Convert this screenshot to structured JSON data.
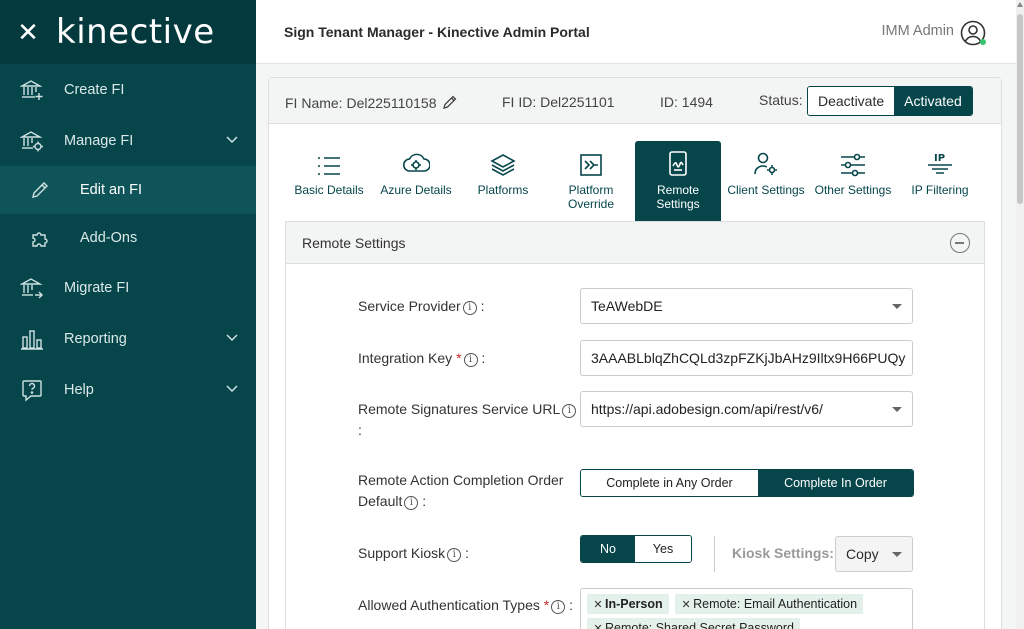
{
  "app": {
    "brand": "kinective",
    "title": "Sign Tenant Manager - Kinective Admin Portal",
    "user": "IMM Admin"
  },
  "sidebar": {
    "items": [
      {
        "label": "Create FI"
      },
      {
        "label": "Manage FI"
      },
      {
        "label": "Edit an FI"
      },
      {
        "label": "Add-Ons"
      },
      {
        "label": "Migrate FI"
      },
      {
        "label": "Reporting"
      },
      {
        "label": "Help"
      }
    ]
  },
  "info": {
    "fi_name": "FI Name: Del225110158",
    "fi_id": "FI ID: Del2251101",
    "id": "ID: 1494",
    "status_label": "Status:",
    "deactivate": "Deactivate",
    "activated": "Activated"
  },
  "tabs": [
    {
      "label": "Basic Details"
    },
    {
      "label": "Azure Details"
    },
    {
      "label": "Platforms"
    },
    {
      "label": "Platform Override"
    },
    {
      "label": "Remote Settings"
    },
    {
      "label": "Client Settings"
    },
    {
      "label": "Other Settings"
    },
    {
      "label": "IP Filtering"
    }
  ],
  "section": {
    "title": "Remote Settings",
    "service_provider": {
      "label": "Service Provider",
      "value": "TeAWebDE"
    },
    "integration_key": {
      "label": "Integration Key",
      "value": "3AAABLblqZhCQLd3zpFZKjJbAHz9Iltx9H66PUQy"
    },
    "remote_url": {
      "label": "Remote Signatures Service URL",
      "value": "https://api.adobesign.com/api/rest/v6/"
    },
    "completion_order": {
      "label": "Remote Action Completion Order Default",
      "opt1": "Complete in Any Order",
      "opt2": "Complete In Order"
    },
    "support_kiosk": {
      "label": "Support Kiosk",
      "no": "No",
      "yes": "Yes"
    },
    "kiosk_settings": {
      "label": "Kiosk Settings:",
      "value": "Copy"
    },
    "auth_types": {
      "label": "Allowed Authentication Types",
      "chips": [
        "In-Person",
        "Remote: Email Authentication",
        "Remote: Shared Secret Password"
      ]
    }
  },
  "colors": {
    "primary": "#06464b",
    "chip": "#e4f1ea",
    "required": "#c62828"
  }
}
